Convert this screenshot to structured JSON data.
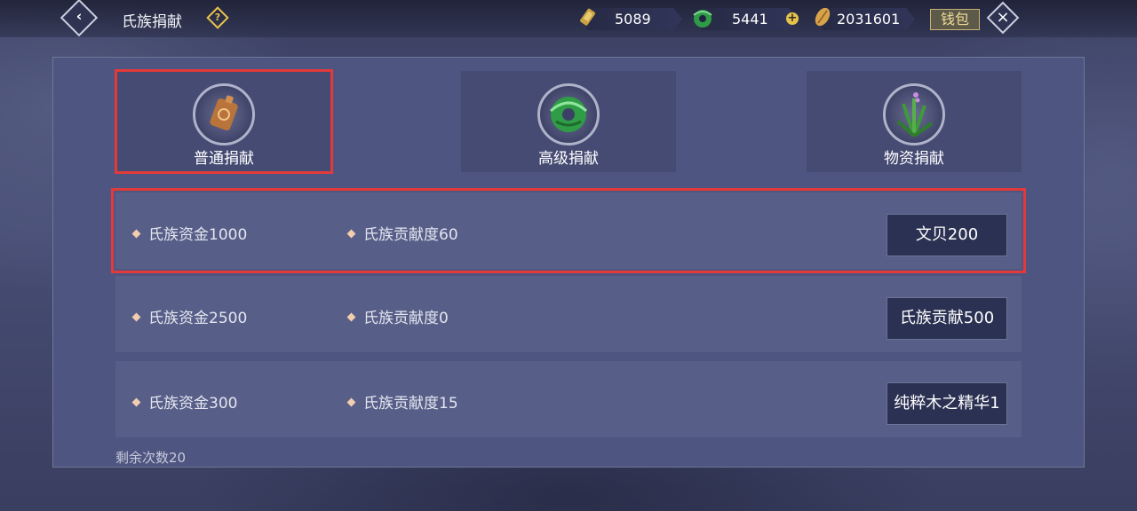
{
  "header": {
    "title": "氏族捐献",
    "currencies": [
      {
        "name": "gold-coin",
        "value": "5089"
      },
      {
        "name": "jade",
        "value": "5441"
      },
      {
        "name": "shell",
        "value": "2031601"
      }
    ],
    "wallet_label": "钱包"
  },
  "tabs": [
    {
      "label": "普通捐献",
      "icon": "bronze-token-icon",
      "selected": true
    },
    {
      "label": "高级捐献",
      "icon": "jade-ring-icon",
      "selected": false
    },
    {
      "label": "物资捐献",
      "icon": "herb-plant-icon",
      "selected": false
    }
  ],
  "rows": [
    {
      "fund": "氏族资金1000",
      "contribution": "氏族贡献度60",
      "cost": "文贝200"
    },
    {
      "fund": "氏族资金2500",
      "contribution": "氏族贡献度0",
      "cost": "氏族贡献500"
    },
    {
      "fund": "氏族资金300",
      "contribution": "氏族贡献度15",
      "cost": "纯粹木之精华1"
    }
  ],
  "remaining": "剩余次数20",
  "colors": {
    "highlight": "#e23a3a",
    "accent": "#e8c34a",
    "panel": "#4e5580"
  }
}
